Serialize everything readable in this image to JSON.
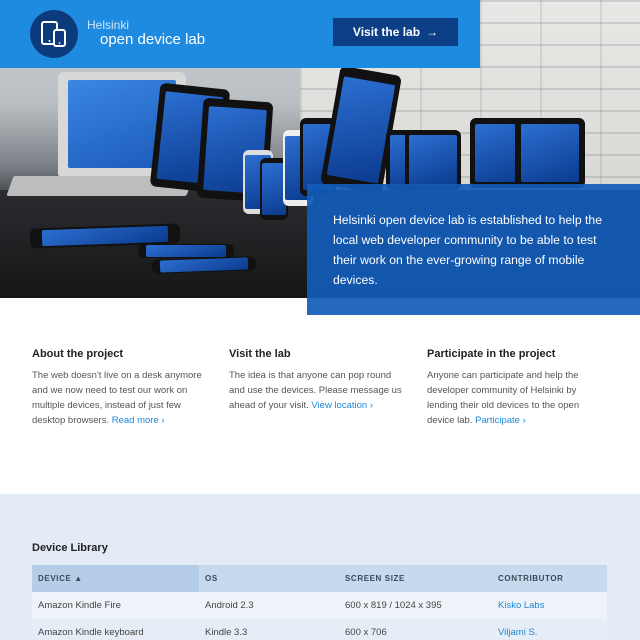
{
  "header": {
    "brand_small": "Helsinki",
    "brand_big": "open device lab",
    "visit_label": "Visit the lab",
    "visit_arrow": "→",
    "bar_color": "#1f8be0"
  },
  "intro": {
    "text": "Helsinki open device lab is established to help the local web developer community to be able to test their work on the ever-growing range of mobile devices."
  },
  "columns": [
    {
      "title": "About the project",
      "text": "The web doesn't live on a desk anymore and we now need to test our work on multiple devices, instead of just few desktop browsers.",
      "link": "Read more ›"
    },
    {
      "title": "Visit the lab",
      "text": "The idea is that anyone can pop round and use the devices. Please message us ahead of your visit.",
      "link": "View location ›"
    },
    {
      "title": "Participate in the project",
      "text": "Anyone can participate and help the developer community of Helsinki by lending their old devices to the open device lab.",
      "link": "Participate ›"
    }
  ],
  "library": {
    "title": "Device Library",
    "headers": [
      "DEVICE ▲",
      "OS",
      "SCREEN SIZE",
      "CONTRIBUTOR"
    ],
    "rows": [
      {
        "device": "Amazon Kindle Fire",
        "os": "Android 2.3",
        "screen": "600 x 819 / 1024 x 395",
        "contributor": "Kisko Labs"
      },
      {
        "device": "Amazon Kindle keyboard",
        "os": "Kindle 3.3",
        "screen": "600 x 706",
        "contributor": "Viljami S."
      }
    ]
  },
  "icons": {
    "logo": "devices-icon",
    "visit_arrow": "arrow-right-icon"
  }
}
